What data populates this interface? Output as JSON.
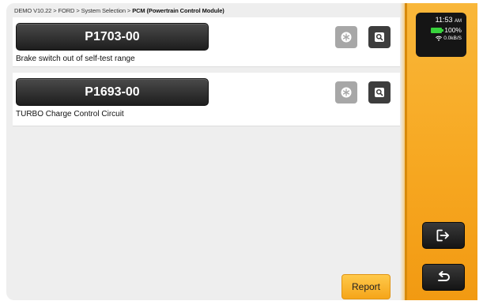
{
  "breadcrumb": {
    "path": "DEMO V10.22 > FORD > System Selection > ",
    "current": "PCM (Powertrain Control Module)"
  },
  "dtcs": [
    {
      "code": "P1703-00",
      "description": "Brake switch out of self-test range"
    },
    {
      "code": "P1693-00",
      "description": "TURBO Charge Control Circuit"
    }
  ],
  "footer": {
    "report_label": "Report"
  },
  "status": {
    "time": "11:53",
    "ampm": "AM",
    "battery": "100%",
    "network": "0.0kB/S"
  },
  "icons": {
    "freeze": "snowflake-icon",
    "search": "search-icon",
    "exit": "exit-icon",
    "back": "back-arrow-icon",
    "battery": "battery-icon",
    "wifi": "wifi-icon"
  },
  "colors": {
    "accent": "#f7a923",
    "code_bg": "#2a2a2a",
    "report_bg": "#ffc94a"
  }
}
